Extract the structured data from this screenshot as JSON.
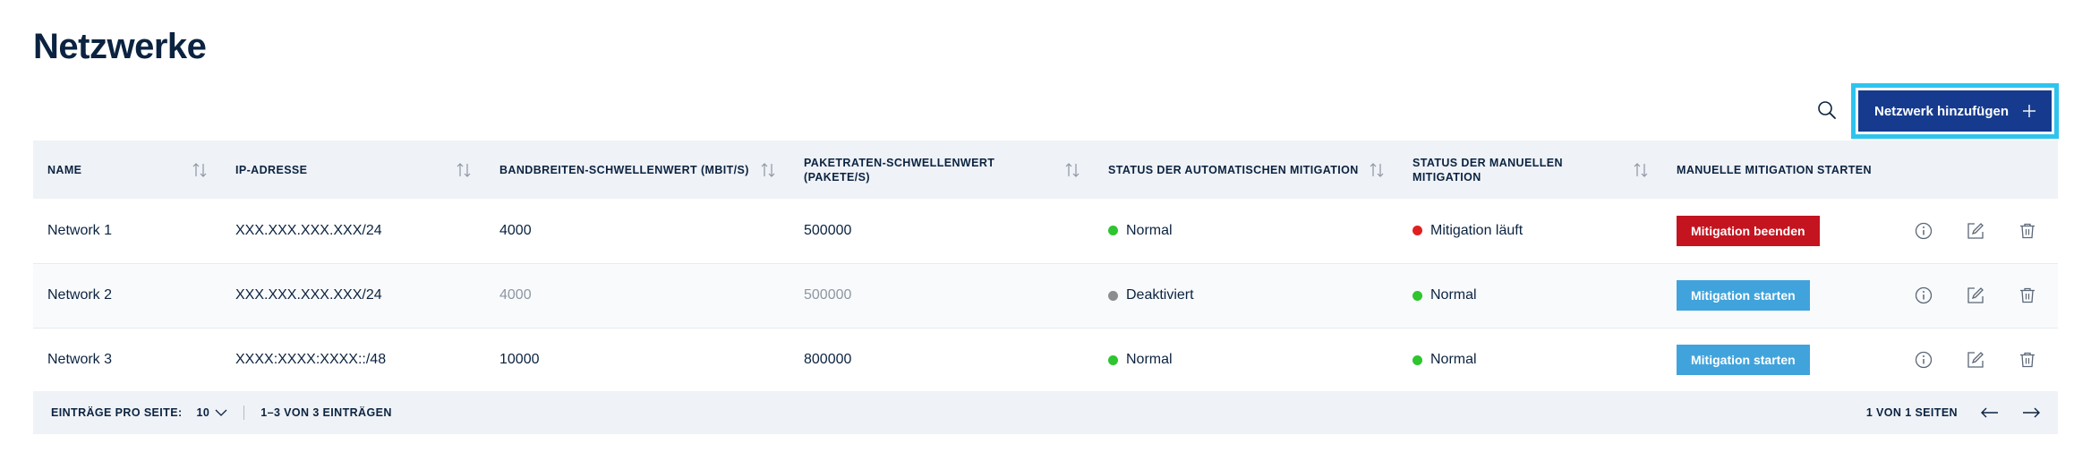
{
  "page": {
    "title": "Netzwerke"
  },
  "toolbar": {
    "add_label": "Netzwerk hinzufügen"
  },
  "table": {
    "columns": [
      "NAME",
      "IP-ADRESSE",
      "BANDBREITEN-SCHWELLENWERT (MBIT/S)",
      "PAKETRATEN-SCHWELLENWERT (PAKETE/S)",
      "STATUS DER AUTOMATISCHEN MITIGATION",
      "STATUS DER MANUELLEN MITIGATION",
      "MANUELLE MITIGATION STARTEN"
    ],
    "rows": [
      {
        "name": "Network 1",
        "ip": "XXX.XXX.XXX.XXX/24",
        "bandwidth": "4000",
        "packet_rate": "500000",
        "auto_status": "Normal",
        "auto_color": "#2ec52e",
        "manual_status": "Mitigation läuft",
        "manual_color": "#e0201c",
        "action": "Mitigation beenden",
        "action_color": "#c4141f"
      },
      {
        "name": "Network 2",
        "ip": "XXX.XXX.XXX.XXX/24",
        "bandwidth": "4000",
        "packet_rate": "500000",
        "auto_status": "Deaktiviert",
        "auto_color": "#8d8d8d",
        "manual_status": "Normal",
        "manual_color": "#2ec52e",
        "action": "Mitigation starten",
        "action_color": "#41a3dc"
      },
      {
        "name": "Network 3",
        "ip": "XXXX:XXXX:XXXX::/48",
        "bandwidth": "10000",
        "packet_rate": "800000",
        "auto_status": "Normal",
        "auto_color": "#2ec52e",
        "manual_status": "Normal",
        "manual_color": "#2ec52e",
        "action": "Mitigation starten",
        "action_color": "#41a3dc"
      }
    ],
    "row_icons": [
      "info-icon",
      "edit-icon",
      "trash-icon"
    ]
  },
  "footer": {
    "per_page_label": "EINTRÄGE PRO SEITE:",
    "per_page_value": "10",
    "range": "1–3 VON 3 EINTRÄGEN",
    "pages": "1 VON 1 SEITEN"
  },
  "colors": {
    "brand_navy": "#163b8e",
    "focus_ring": "#2ec4ee",
    "header_bg": "#eff2f7",
    "title": "#0b2340"
  }
}
